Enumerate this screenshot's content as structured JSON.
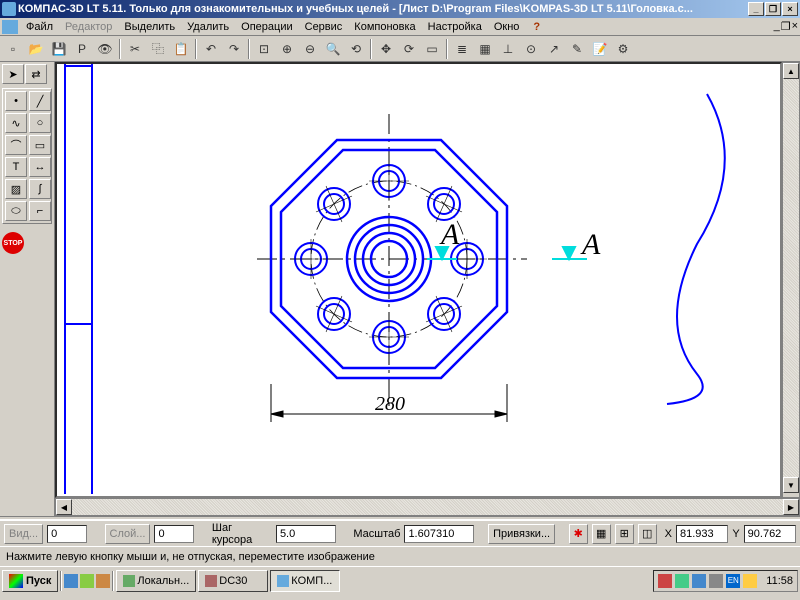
{
  "title": "КОМПАС-3D LT 5.11. Только для ознакомительных и учебных целей - [Лист D:\\Program Files\\KOMPAS-3D LT 5.11\\Головка.c...",
  "menu": {
    "file": "Файл",
    "editor": "Редактор",
    "select": "Выделить",
    "delete": "Удалить",
    "operations": "Операции",
    "service": "Сервис",
    "layout": "Компоновка",
    "settings": "Настройка",
    "window": "Окно",
    "help": "?"
  },
  "bottombar": {
    "view": "Вид...",
    "view_val": "0",
    "layer": "Слой...",
    "layer_val": "0",
    "cursor_step": "Шаг курсора",
    "step_val": "5.0",
    "scale": "Масштаб",
    "scale_val": "1.607310",
    "snap": "Привязки...",
    "x_label": "X",
    "x_val": "81.933",
    "y_label": "Y",
    "y_val": "90.762"
  },
  "statusbar": "Нажмите левую кнопку мыши и, не отпуская, переместите изображение",
  "taskbar": {
    "start": "Пуск",
    "task1": "Локальн...",
    "task2": "DC30",
    "task3": "КОМП...",
    "clock": "11:58"
  },
  "drawing": {
    "dimension": "280",
    "letter": "А"
  },
  "icons": {
    "new": "▫",
    "open": "📂",
    "save": "💾",
    "print": "🖨",
    "cut": "✂",
    "copy": "⿻",
    "paste": "📋",
    "undo": "↶",
    "redo": "↷",
    "zoomall": "⊡",
    "zoomin": "⊕",
    "zoomout": "⊖",
    "zoomwin": "🔍",
    "pan": "✥",
    "redraw": "⟳",
    "grid": "▦"
  }
}
